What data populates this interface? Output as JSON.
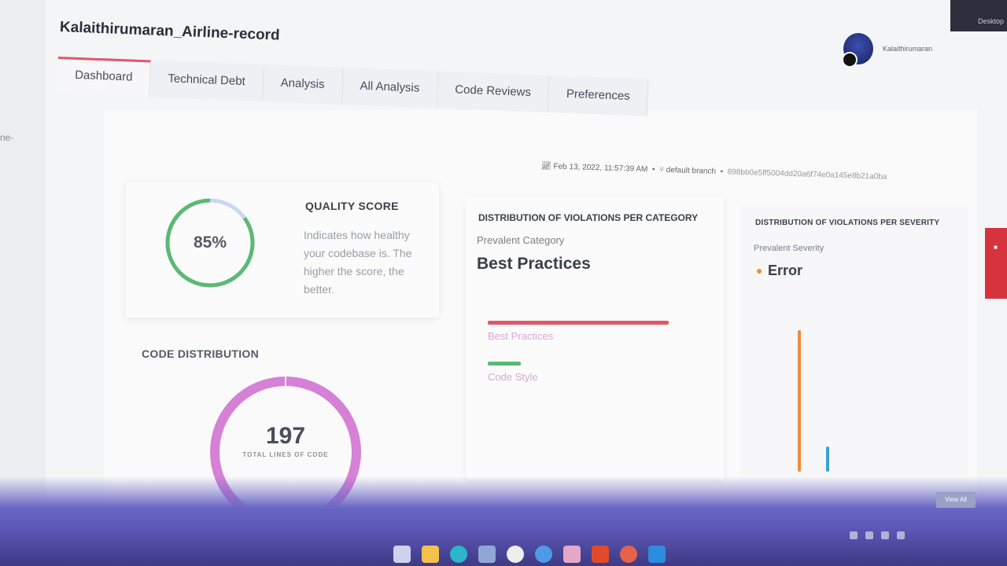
{
  "app": {
    "title": "Kalaithirumaran_Airline-record",
    "username": "Kalaithirumaran"
  },
  "edge_fragment": "ne-",
  "top_strip": "Desktop",
  "tabs": [
    {
      "label": "Dashboard",
      "active": true
    },
    {
      "label": "Technical Debt",
      "active": false
    },
    {
      "label": "Analysis",
      "active": false
    },
    {
      "label": "All Analysis",
      "active": false
    },
    {
      "label": "Code Reviews",
      "active": false
    },
    {
      "label": "Preferences",
      "active": false
    }
  ],
  "meta": {
    "timestamp": "Feb 13, 2022, 11:57:39 AM",
    "branch": "default branch",
    "commit": "698bb0e5ff5004dd20a6f74e0a145e8b21a0ba"
  },
  "quality": {
    "score": 85,
    "score_label": "85%",
    "title": "QUALITY SCORE",
    "description": "Indicates how healthy your codebase is. The higher the score, the better."
  },
  "category": {
    "title": "DISTRIBUTION OF VIOLATIONS PER CATEGORY",
    "prevalent_label": "Prevalent Category",
    "prevalent_value": "Best Practices",
    "items": [
      {
        "label": "Best Practices",
        "value": 0.82,
        "color": "#e05769"
      },
      {
        "label": "Code Style",
        "value": 0.15,
        "color": "#5bb974"
      }
    ]
  },
  "severity": {
    "title": "DISTRIBUTION OF VIOLATIONS PER SEVERITY",
    "prevalent_label": "Prevalent Severity",
    "prevalent_value": "Error",
    "bars": [
      {
        "value": 1.0,
        "color": "#f08a3c"
      },
      {
        "value": 0.18,
        "color": "#3aa0d8"
      }
    ]
  },
  "code_distribution": {
    "title": "CODE DISTRIBUTION",
    "total": "197",
    "total_label": "TOTAL LINES OF CODE",
    "color": "#d680d6"
  },
  "colors": {
    "accent": "#e05769",
    "ring_good": "#5bb974",
    "ring_track": "#c8d8ef"
  },
  "view_button": "View All"
}
